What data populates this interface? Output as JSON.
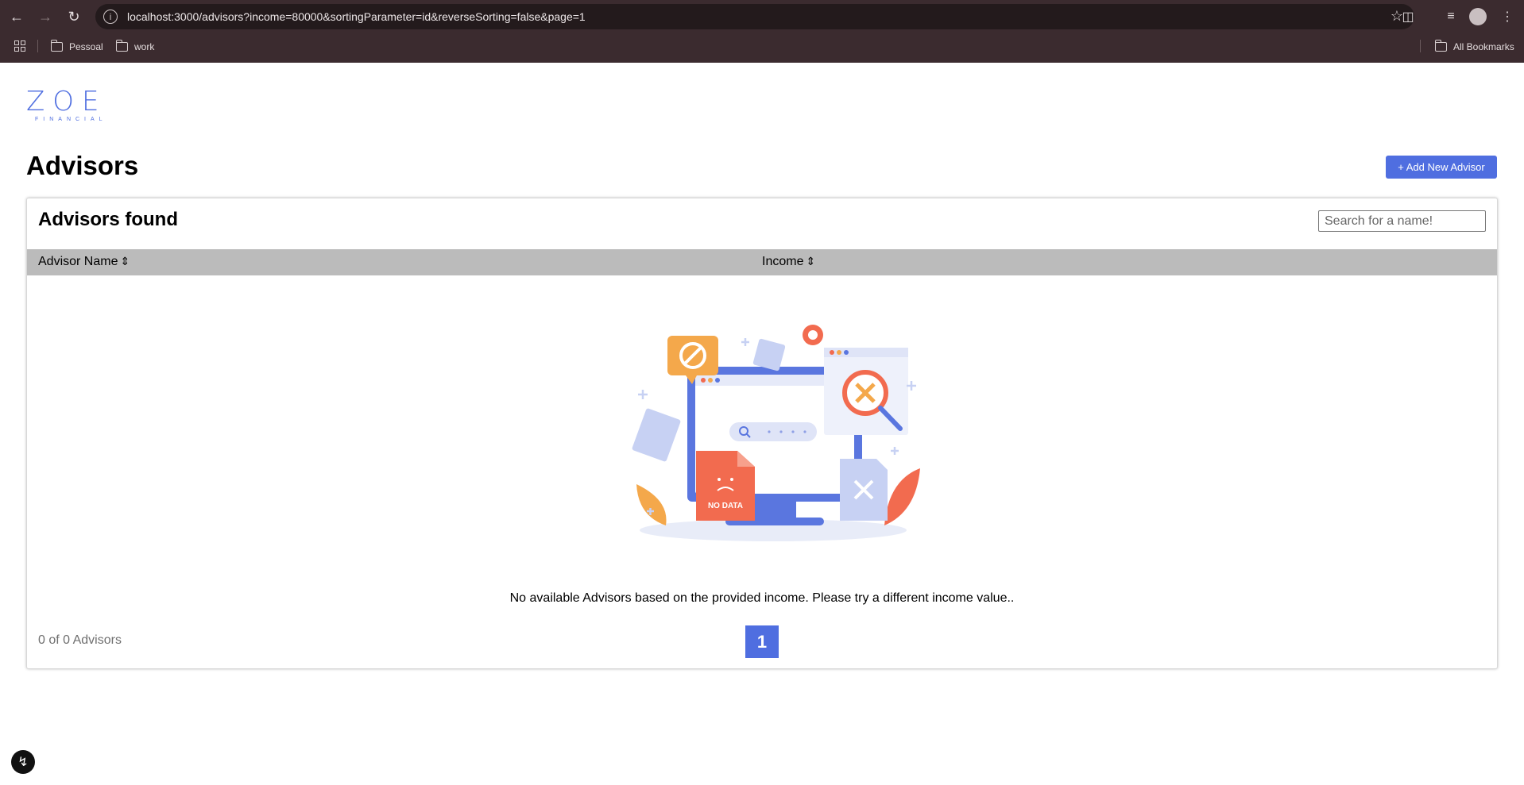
{
  "browser": {
    "url": "localhost:3000/advisors?income=80000&sortingParameter=id&reverseSorting=false&page=1",
    "bookmarks": [
      "Pessoal",
      "work"
    ],
    "all_bookmarks": "All Bookmarks"
  },
  "logo": {
    "main": "ZOE",
    "sub": "FINANCIAL"
  },
  "header": {
    "title": "Advisors",
    "add_button": "+ Add New Advisor"
  },
  "card": {
    "title": "Advisors found",
    "search_placeholder": "Search for a name!",
    "columns": [
      {
        "label": "Advisor Name",
        "sort_glyph": "⇕"
      },
      {
        "label": "Income",
        "sort_glyph": "⇕"
      }
    ],
    "illustration_label": "NO DATA",
    "empty_message": "No available Advisors based on the provided income. Please try a different income value..",
    "count_text": "0 of 0 Advisors",
    "pages": [
      "1"
    ]
  },
  "colors": {
    "accent": "#4f6ee0",
    "table_header": "#bbbbbb",
    "chrome": "#3b2b2f"
  }
}
